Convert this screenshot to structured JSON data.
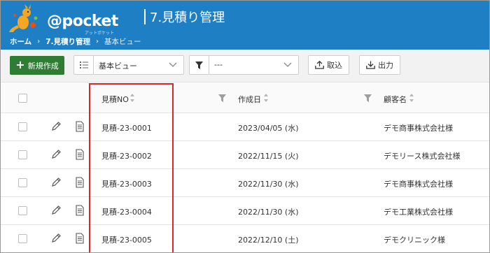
{
  "app": {
    "logo_text": "@pocket",
    "logo_sub": "アットポケット",
    "title": "7.見積り管理"
  },
  "breadcrumb": {
    "home": "ホーム",
    "section": "7.見積り管理",
    "current": "基本ビュー"
  },
  "toolbar": {
    "new_label": "新規作成",
    "view_value": "基本ビュー",
    "filter_value": "---",
    "import_label": "取込",
    "export_label": "出力"
  },
  "table": {
    "columns": [
      "見積NO",
      "作成日",
      "顧客名"
    ],
    "rows": [
      {
        "no": "見積-23-0001",
        "date": "2023/04/05 (水)",
        "customer": "デモ商事株式会社様"
      },
      {
        "no": "見積-23-0002",
        "date": "2022/11/15 (火)",
        "customer": "デモリース株式会社様"
      },
      {
        "no": "見積-23-0003",
        "date": "2022/11/30 (水)",
        "customer": "デモ商事株式会社様"
      },
      {
        "no": "見積-23-0004",
        "date": "2022/11/30 (水)",
        "customer": "デモ工業株式会社様"
      },
      {
        "no": "見積-23-0005",
        "date": "2022/12/10 (土)",
        "customer": "デモクリニック様"
      }
    ]
  },
  "colors": {
    "header_bg": "#1f7fc4",
    "new_button": "#2e7d32",
    "highlight": "#d9262b"
  },
  "icons": [
    "kangaroo-logo-icon",
    "list-icon",
    "funnel-icon",
    "chevron-down-icon",
    "upload-icon",
    "download-icon",
    "sort-icon",
    "pencil-icon",
    "document-icon"
  ]
}
